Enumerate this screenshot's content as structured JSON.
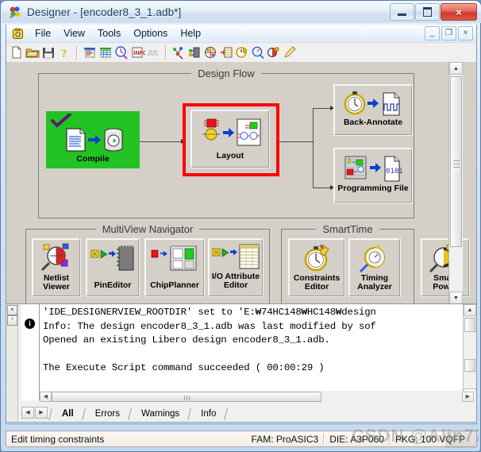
{
  "window": {
    "title": "Designer - [encoder8_3_1.adb*]",
    "app_icon": "designer-app-icon",
    "buttons": {
      "minimize": "minimize-icon",
      "maximize": "maximize-icon",
      "close": "×"
    }
  },
  "mdi_child": {
    "app_icon": "libero-doc-icon",
    "menus": [
      "File",
      "View",
      "Tools",
      "Options",
      "Help"
    ],
    "buttons": {
      "minimize": "_",
      "restore": "❐",
      "close": "×"
    }
  },
  "toolbar": {
    "group1": [
      "new-file-icon",
      "open-folder-icon",
      "save-disk-icon",
      "help-question-icon"
    ],
    "group2": [
      "compile-icon",
      "layout-icon",
      "timing-clock-icon",
      "programming-info-icon",
      "waveform-icon"
    ],
    "group3": [
      "netlist-viewer-icon",
      "pin-editor-icon",
      "chip-planner-icon",
      "io-attribute-icon",
      "constraints-editor-icon",
      "timing-analyzer-icon",
      "smart-power-icon",
      "edit-pencil-icon"
    ]
  },
  "design_flow": {
    "group_label": "Design Flow",
    "nodes": [
      {
        "id": "compile",
        "label": "Compile",
        "state": "complete",
        "icon": "compile-icon",
        "checkmark": true,
        "highlight_color": "#22c322"
      },
      {
        "id": "layout",
        "label": "Layout",
        "state": "selected",
        "icon": "layout-icon",
        "selection_color": "#fe0000"
      },
      {
        "id": "back-annotate",
        "label": "Back-Annotate",
        "state": "idle",
        "icon": "back-annotate-icon"
      },
      {
        "id": "programming-file",
        "label": "Programming File",
        "state": "idle",
        "icon": "programming-file-icon"
      }
    ]
  },
  "multiview_navigator": {
    "group_label": "MultiView Navigator",
    "tools": [
      {
        "label": "Netlist\nViewer",
        "line1": "Netlist",
        "line2": "Viewer",
        "icon": "netlist-viewer-icon"
      },
      {
        "label": "PinEditor",
        "line1": "PinEditor",
        "line2": "",
        "icon": "pin-editor-icon"
      },
      {
        "label": "ChipPlanner",
        "line1": "ChipPlanner",
        "line2": "",
        "icon": "chip-planner-icon"
      },
      {
        "label": "I/O Attribute Editor",
        "line1": "I/O Attribute",
        "line2": "Editor",
        "icon": "io-attribute-editor-icon"
      }
    ]
  },
  "smarttime": {
    "group_label": "SmartTime",
    "tools": [
      {
        "line1": "Constraints",
        "line2": "Editor",
        "icon": "constraints-editor-icon"
      },
      {
        "line1": "Timing",
        "line2": "Analyzer",
        "icon": "timing-analyzer-icon"
      },
      {
        "line1": "Smart",
        "line2": "Power",
        "icon": "smart-power-icon"
      }
    ]
  },
  "log": {
    "gutter_icon": "info-icon",
    "lines": [
      "'IDE_DESIGNERVIEW_ROOTDIR' set to 'E:₩74HC148₩HC148₩design",
      "Info: The design encoder8_3_1.adb was last modified by sof",
      "Opened an existing Libero design encoder8_3_1.adb.",
      "",
      "The Execute Script command succeeded ( 00:00:29 )"
    ],
    "tabs": [
      {
        "label": "All",
        "active": true
      },
      {
        "label": "Errors",
        "active": false
      },
      {
        "label": "Warnings",
        "active": false
      },
      {
        "label": "Info",
        "active": false
      }
    ],
    "nav_prev": "◀",
    "nav_next": "▶"
  },
  "statusbar": {
    "message": "Edit timing constraints",
    "family": "FAM: ProASIC3",
    "die": "DIE: A3P060",
    "package": "PKG: 100 VQFP",
    "watermark": "CSDN @Alin77"
  },
  "colors": {
    "desktop": "#6b8fb8",
    "canvas": "#d4d0c8",
    "selection": "#fe0000",
    "complete": "#22c322",
    "titlebar_text": "#1b3a5c"
  }
}
